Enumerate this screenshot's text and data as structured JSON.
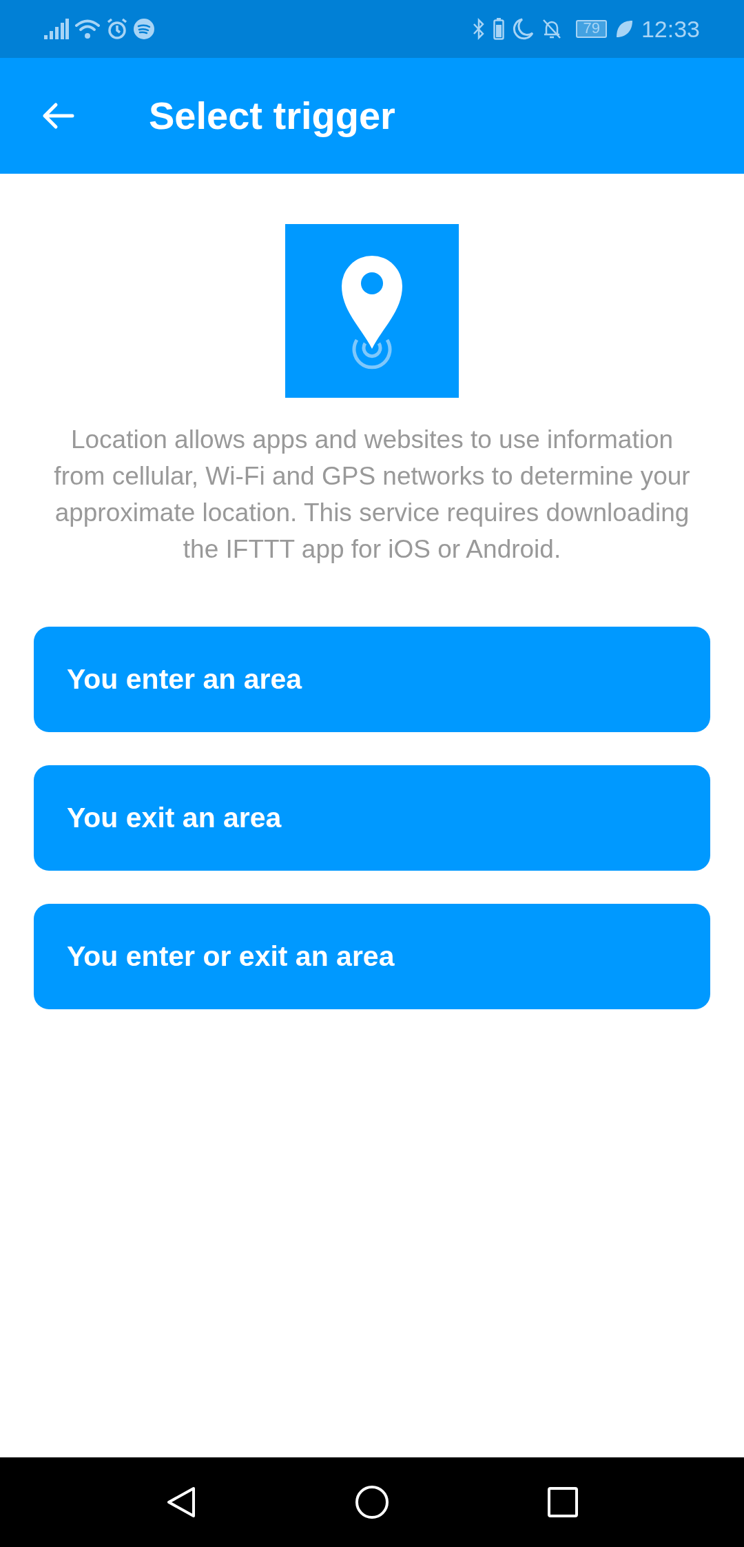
{
  "status_bar": {
    "battery": "79",
    "time": "12:33"
  },
  "header": {
    "title": "Select trigger"
  },
  "service": {
    "description": "Location allows apps and websites to use information from cellular, Wi-Fi and GPS networks to determine your approximate location. This service requires downloading the IFTTT app for iOS or Android."
  },
  "triggers": [
    {
      "label": "You enter an area"
    },
    {
      "label": "You exit an area"
    },
    {
      "label": "You enter or exit an area"
    }
  ]
}
